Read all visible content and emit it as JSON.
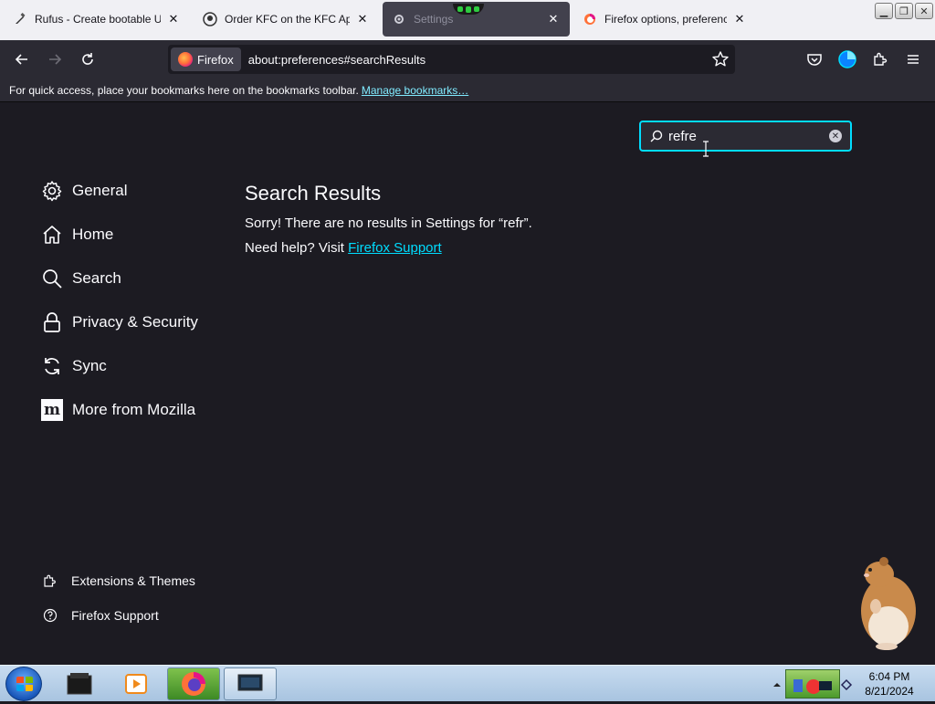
{
  "tabs": [
    {
      "title": "Rufus - Create bootable USB",
      "icon": "rufus-icon",
      "active": false
    },
    {
      "title": "Order KFC on the KFC App, D",
      "icon": "kfc-icon",
      "active": false
    },
    {
      "title": "Settings",
      "icon": "settings-icon",
      "active": true
    },
    {
      "title": "Firefox options, preferences a",
      "icon": "firefox-icon",
      "active": false
    }
  ],
  "navbar": {
    "identity_label": "Firefox",
    "url": "about:preferences#searchResults"
  },
  "bookmarks_bar": {
    "message": "For quick access, place your bookmarks here on the bookmarks toolbar.",
    "link": "Manage bookmarks…"
  },
  "search": {
    "value": "refre"
  },
  "categories": [
    {
      "label": "General",
      "icon": "gear-icon"
    },
    {
      "label": "Home",
      "icon": "home-icon"
    },
    {
      "label": "Search",
      "icon": "search-icon"
    },
    {
      "label": "Privacy & Security",
      "icon": "lock-icon"
    },
    {
      "label": "Sync",
      "icon": "sync-icon"
    },
    {
      "label": "More from Mozilla",
      "icon": "mozilla-icon"
    }
  ],
  "footer_links": [
    {
      "label": "Extensions & Themes",
      "icon": "puzzle-icon"
    },
    {
      "label": "Firefox Support",
      "icon": "help-icon"
    }
  ],
  "results": {
    "title": "Search Results",
    "no_results": "Sorry! There are no results in Settings for “refr”.",
    "need_help": "Need help? Visit",
    "support_link": "Firefox Support"
  },
  "taskbar": {
    "time": "6:04 PM",
    "date": "8/21/2024"
  },
  "colors": {
    "accent": "#00ddff",
    "page_bg": "#1c1b22",
    "toolbar_bg": "#2b2a33"
  }
}
